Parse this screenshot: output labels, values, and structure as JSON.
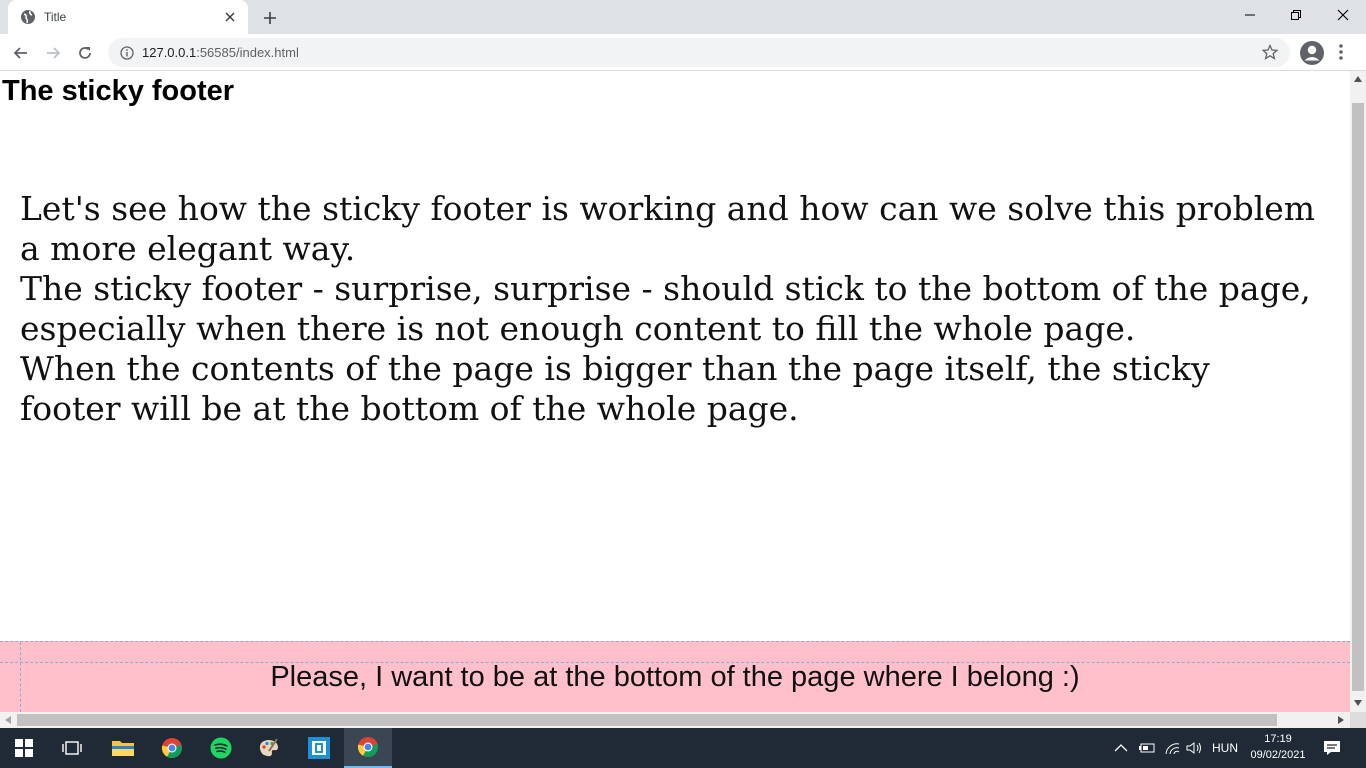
{
  "browser": {
    "tab_title": "Title",
    "url_host": "127.0.0.1",
    "url_rest": ":56585/index.html"
  },
  "page": {
    "title": "The sticky footer",
    "paragraphs": [
      "Let's see how the sticky footer is working and how can we solve this problem a more elegant way.",
      "The sticky footer - surprise, surprise - should stick to the bottom of the page, especially when there is not enough content to fill the whole page.",
      "When the contents of the page is bigger than the page itself, the sticky footer will be at the bottom of the whole page."
    ],
    "footer_text": "Please, I want to be at the bottom of the page where I belong :)"
  },
  "taskbar": {
    "language": "HUN",
    "time": "17:19",
    "date": "09/02/2021"
  },
  "colors": {
    "footer_bg": "#ffc0cb",
    "taskbar_bg": "#1f2a36"
  }
}
